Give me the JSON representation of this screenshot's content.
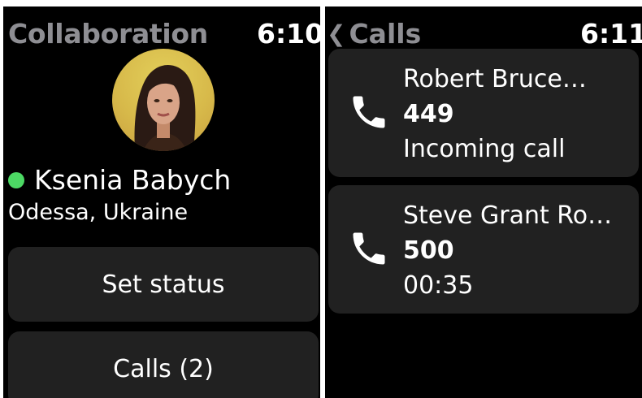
{
  "left_screen": {
    "title": "Collaboration",
    "time": "6:10",
    "user": {
      "name": "Ksenia Babych",
      "location": "Odessa, Ukraine",
      "status_color": "#4cd964"
    },
    "buttons": [
      {
        "label": "Set status"
      },
      {
        "label": "Calls (2)"
      }
    ]
  },
  "right_screen": {
    "back_icon": "chevron-left-icon",
    "title": "Calls",
    "time": "6:11",
    "calls": [
      {
        "name": "Robert Bruce…",
        "number": "449",
        "detail": "Incoming call",
        "icon": "phone-icon"
      },
      {
        "name": "Steve Grant Ro…",
        "number": "500",
        "detail": "00:35",
        "icon": "phone-icon"
      }
    ]
  }
}
